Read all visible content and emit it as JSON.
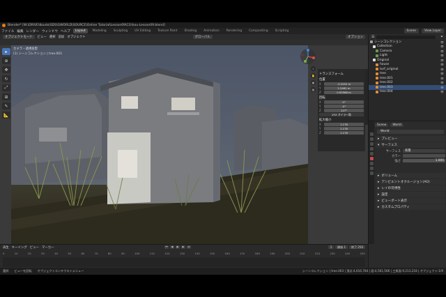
{
  "title_bar": {
    "text": "Blender* [W:\\DRIVE\\Koudo\\SDS\\GWORLD\\SOURCE\\Online Tutorial\\Lesson09\\CG\\hou-Lesson09.blend]"
  },
  "menu": {
    "items": [
      "ファイル",
      "編集",
      "レンダー",
      "ウィンドウ",
      "ヘルプ"
    ],
    "workspaces": [
      "Layout",
      "Modeling",
      "Sculpting",
      "UV Editing",
      "Texture Paint",
      "Shading",
      "Animation",
      "Rendering",
      "Compositing",
      "Scripting"
    ],
    "active_workspace": "Layout",
    "scene_label": "Scene",
    "view_layer_label": "View Layer"
  },
  "viewport": {
    "header": {
      "mode": "オブジェクトモード",
      "items": [
        "ビュー",
        "選択",
        "追加",
        "オブジェクト"
      ],
      "orientation": "グローバル",
      "options": "オプション"
    },
    "camera_label_1": "カメラ・透視投影",
    "camera_label_2": "(1) シーンコレクション | tree.003"
  },
  "npanel": {
    "section_item": "項目",
    "section_transform": "トランスフォーム",
    "location_label": "位置",
    "location": [
      "-3.2252 m",
      "2.2461 m",
      "0.92568 m"
    ],
    "rotation_label": "回転",
    "rotation": [
      "0°",
      "-0°",
      "127°"
    ],
    "rotation_mode": "XYZ オイラー角",
    "scale_label": "拡大縮小",
    "scale": [
      "1.178",
      "1.178",
      "1.178"
    ]
  },
  "outliner": {
    "items": [
      {
        "label": "シーンコレクション",
        "color": "#a0a0a0"
      },
      {
        "label": "Collection",
        "color": "#e0e0e0"
      },
      {
        "label": "Camera",
        "color": "#6b9e4a"
      },
      {
        "label": "Light",
        "color": "#6b9e4a"
      },
      {
        "label": "Original",
        "color": "#e0e0e0"
      },
      {
        "label": "house",
        "color": "#e18c3c"
      },
      {
        "label": "turf_original",
        "color": "#e18c3c"
      },
      {
        "label": "tree",
        "color": "#e18c3c"
      },
      {
        "label": "tree.001",
        "color": "#e18c3c"
      },
      {
        "label": "tree.002",
        "color": "#e18c3c"
      },
      {
        "label": "tree.003",
        "color": "#e18c3c"
      },
      {
        "label": "tree.004",
        "color": "#e18c3c"
      }
    ]
  },
  "properties": {
    "scene_pill": "Scene",
    "world_pill": "World",
    "world_name": "World",
    "panels": [
      "プレビュー",
      "サーフェス"
    ],
    "surface_label": "サーフェス",
    "surface_value": "背景",
    "color_label": "カラー",
    "strength_label": "強さ",
    "strength_value": "1.000",
    "collapsed_panels": [
      "ボリューム",
      "アンビエントオクルージョン(AO)",
      "レイの可視性",
      "設定",
      "ビューポート表示",
      "カスタムプロパティ"
    ]
  },
  "timeline": {
    "header": [
      "再生",
      "キーイング",
      "ビュー",
      "マーカー"
    ],
    "start_label": "開始",
    "start_value": "1",
    "end_label": "終了",
    "end_value": "250",
    "current_frame": "1",
    "ticks": [
      "0",
      "10",
      "20",
      "30",
      "40",
      "50",
      "60",
      "70",
      "80",
      "90",
      "100",
      "110",
      "120",
      "130",
      "140",
      "150",
      "160",
      "170",
      "180",
      "190",
      "200",
      "210",
      "220",
      "230",
      "240",
      "250"
    ]
  },
  "status": {
    "left": "選択",
    "mid1": "ビューを回転",
    "mid2": "オブジェクトコンテクストメニュー",
    "right": "シーンコレクション | tree.003 | 頂点:4,616,784 | 面:4,561,566 | 三角面:9,213,218 | オブジェクト:1/9"
  },
  "colors": {
    "accent": "#4773b3",
    "object": "#e18c3c",
    "world_tab": "#c8484c"
  }
}
